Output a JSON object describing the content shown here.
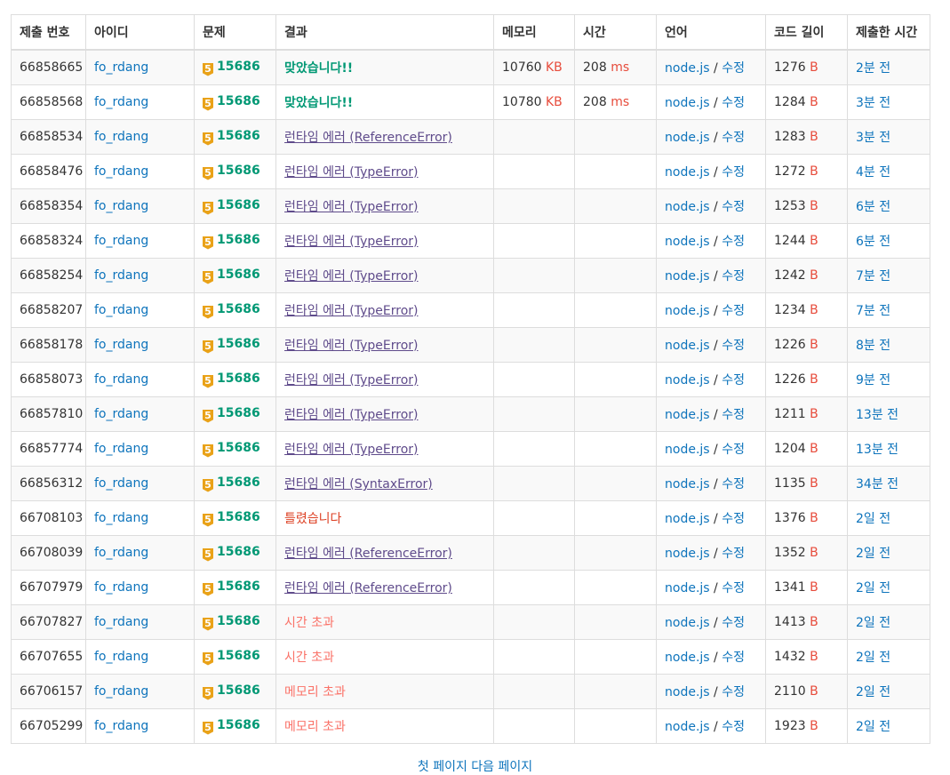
{
  "headers": [
    "제출 번호",
    "아이디",
    "문제",
    "결과",
    "메모리",
    "시간",
    "언어",
    "코드 길이",
    "제출한 시간"
  ],
  "units": {
    "memory": "KB",
    "time": "ms",
    "code": "B"
  },
  "lang_sep": " / ",
  "edit_label": "수정",
  "tier_glyph": "5",
  "colors": {
    "link": "#0e74bc",
    "accepted": "#009874",
    "wrong": "#dd4124",
    "runtime_error": "#5f4b8b",
    "limit_exceeded": "#fa7268",
    "tier_gold": "#e9a218",
    "unit": "#e74c3c"
  },
  "icons": {
    "tier": "gold-v-tier-badge"
  },
  "rows": [
    {
      "id": "66858665",
      "user": "fo_rdang",
      "problem": "15686",
      "result": "맞았습니다!!",
      "result_type": "ac",
      "memory": "10760",
      "time": "208",
      "lang": "node.js",
      "length": "1276",
      "submitted": "2분 전"
    },
    {
      "id": "66858568",
      "user": "fo_rdang",
      "problem": "15686",
      "result": "맞았습니다!!",
      "result_type": "ac",
      "memory": "10780",
      "time": "208",
      "lang": "node.js",
      "length": "1284",
      "submitted": "3분 전"
    },
    {
      "id": "66858534",
      "user": "fo_rdang",
      "problem": "15686",
      "result": "런타임 에러 (ReferenceError)",
      "result_type": "rte",
      "memory": "",
      "time": "",
      "lang": "node.js",
      "length": "1283",
      "submitted": "3분 전"
    },
    {
      "id": "66858476",
      "user": "fo_rdang",
      "problem": "15686",
      "result": "런타임 에러 (TypeError)",
      "result_type": "rte",
      "memory": "",
      "time": "",
      "lang": "node.js",
      "length": "1272",
      "submitted": "4분 전"
    },
    {
      "id": "66858354",
      "user": "fo_rdang",
      "problem": "15686",
      "result": "런타임 에러 (TypeError)",
      "result_type": "rte",
      "memory": "",
      "time": "",
      "lang": "node.js",
      "length": "1253",
      "submitted": "6분 전"
    },
    {
      "id": "66858324",
      "user": "fo_rdang",
      "problem": "15686",
      "result": "런타임 에러 (TypeError)",
      "result_type": "rte",
      "memory": "",
      "time": "",
      "lang": "node.js",
      "length": "1244",
      "submitted": "6분 전"
    },
    {
      "id": "66858254",
      "user": "fo_rdang",
      "problem": "15686",
      "result": "런타임 에러 (TypeError)",
      "result_type": "rte",
      "memory": "",
      "time": "",
      "lang": "node.js",
      "length": "1242",
      "submitted": "7분 전"
    },
    {
      "id": "66858207",
      "user": "fo_rdang",
      "problem": "15686",
      "result": "런타임 에러 (TypeError)",
      "result_type": "rte",
      "memory": "",
      "time": "",
      "lang": "node.js",
      "length": "1234",
      "submitted": "7분 전"
    },
    {
      "id": "66858178",
      "user": "fo_rdang",
      "problem": "15686",
      "result": "런타임 에러 (TypeError)",
      "result_type": "rte",
      "memory": "",
      "time": "",
      "lang": "node.js",
      "length": "1226",
      "submitted": "8분 전"
    },
    {
      "id": "66858073",
      "user": "fo_rdang",
      "problem": "15686",
      "result": "런타임 에러 (TypeError)",
      "result_type": "rte",
      "memory": "",
      "time": "",
      "lang": "node.js",
      "length": "1226",
      "submitted": "9분 전"
    },
    {
      "id": "66857810",
      "user": "fo_rdang",
      "problem": "15686",
      "result": "런타임 에러 (TypeError)",
      "result_type": "rte",
      "memory": "",
      "time": "",
      "lang": "node.js",
      "length": "1211",
      "submitted": "13분 전"
    },
    {
      "id": "66857774",
      "user": "fo_rdang",
      "problem": "15686",
      "result": "런타임 에러 (TypeError)",
      "result_type": "rte",
      "memory": "",
      "time": "",
      "lang": "node.js",
      "length": "1204",
      "submitted": "13분 전"
    },
    {
      "id": "66856312",
      "user": "fo_rdang",
      "problem": "15686",
      "result": "런타임 에러 (SyntaxError)",
      "result_type": "rte",
      "memory": "",
      "time": "",
      "lang": "node.js",
      "length": "1135",
      "submitted": "34분 전"
    },
    {
      "id": "66708103",
      "user": "fo_rdang",
      "problem": "15686",
      "result": "틀렸습니다",
      "result_type": "wa",
      "memory": "",
      "time": "",
      "lang": "node.js",
      "length": "1376",
      "submitted": "2일 전"
    },
    {
      "id": "66708039",
      "user": "fo_rdang",
      "problem": "15686",
      "result": "런타임 에러 (ReferenceError)",
      "result_type": "rte",
      "memory": "",
      "time": "",
      "lang": "node.js",
      "length": "1352",
      "submitted": "2일 전"
    },
    {
      "id": "66707979",
      "user": "fo_rdang",
      "problem": "15686",
      "result": "런타임 에러 (ReferenceError)",
      "result_type": "rte",
      "memory": "",
      "time": "",
      "lang": "node.js",
      "length": "1341",
      "submitted": "2일 전"
    },
    {
      "id": "66707827",
      "user": "fo_rdang",
      "problem": "15686",
      "result": "시간 초과",
      "result_type": "tle",
      "memory": "",
      "time": "",
      "lang": "node.js",
      "length": "1413",
      "submitted": "2일 전"
    },
    {
      "id": "66707655",
      "user": "fo_rdang",
      "problem": "15686",
      "result": "시간 초과",
      "result_type": "tle",
      "memory": "",
      "time": "",
      "lang": "node.js",
      "length": "1432",
      "submitted": "2일 전"
    },
    {
      "id": "66706157",
      "user": "fo_rdang",
      "problem": "15686",
      "result": "메모리 초과",
      "result_type": "mle",
      "memory": "",
      "time": "",
      "lang": "node.js",
      "length": "2110",
      "submitted": "2일 전"
    },
    {
      "id": "66705299",
      "user": "fo_rdang",
      "problem": "15686",
      "result": "메모리 초과",
      "result_type": "mle",
      "memory": "",
      "time": "",
      "lang": "node.js",
      "length": "1923",
      "submitted": "2일 전"
    }
  ],
  "bottom_link": "첫 페이지 다음 페이지"
}
